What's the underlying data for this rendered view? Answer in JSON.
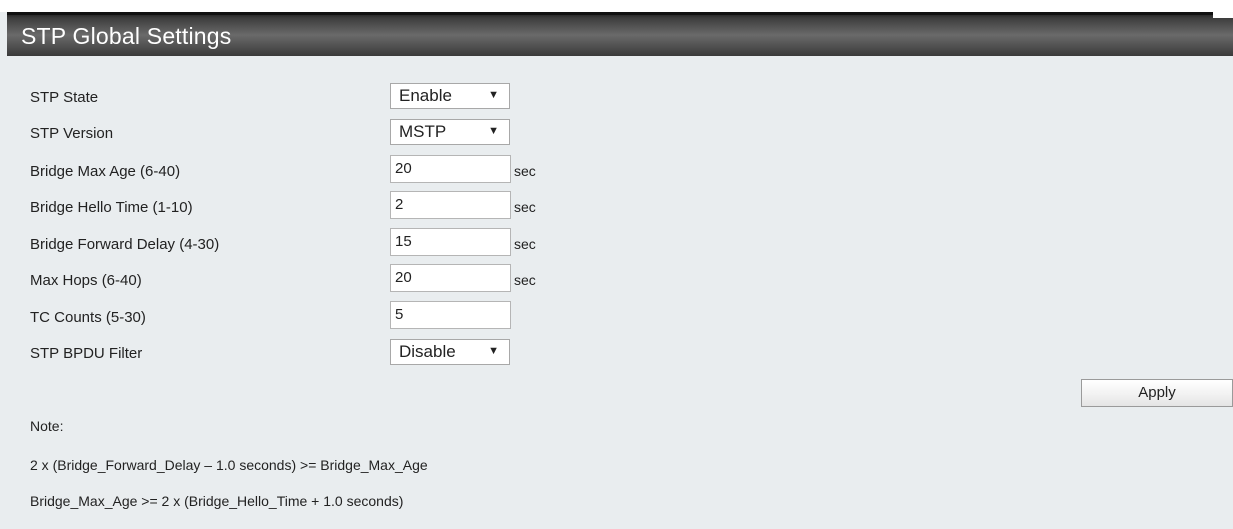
{
  "panel": {
    "title": "STP Global Settings"
  },
  "fields": {
    "stp_state": {
      "label": "STP State",
      "value": "Enable"
    },
    "stp_version": {
      "label": "STP Version",
      "value": "MSTP"
    },
    "bridge_max_age": {
      "label": "Bridge Max Age (6-40)",
      "value": "20",
      "unit": "sec"
    },
    "bridge_hello_time": {
      "label": "Bridge Hello Time (1-10)",
      "value": "2",
      "unit": "sec"
    },
    "bridge_forward_delay": {
      "label": "Bridge Forward Delay (4-30)",
      "value": "15",
      "unit": "sec"
    },
    "max_hops": {
      "label": "Max Hops (6-40)",
      "value": "20",
      "unit": "sec"
    },
    "tc_counts": {
      "label": "TC Counts (5-30)",
      "value": "5"
    },
    "stp_bpdu_filter": {
      "label": "STP BPDU Filter",
      "value": "Disable"
    }
  },
  "dropdown_arrow": "▼",
  "apply_label": "Apply",
  "notes": {
    "heading": "Note:",
    "line1": "2 x (Bridge_Forward_Delay – 1.0 seconds) >= Bridge_Max_Age",
    "line2": "Bridge_Max_Age >= 2 x (Bridge_Hello_Time + 1.0 seconds)"
  },
  "colors": {
    "page_background": "#e9edef",
    "title_bar": "#4a4a4a",
    "title_text": "#ffffff"
  },
  "icons": {
    "dropdown": "chevron-down-icon"
  }
}
